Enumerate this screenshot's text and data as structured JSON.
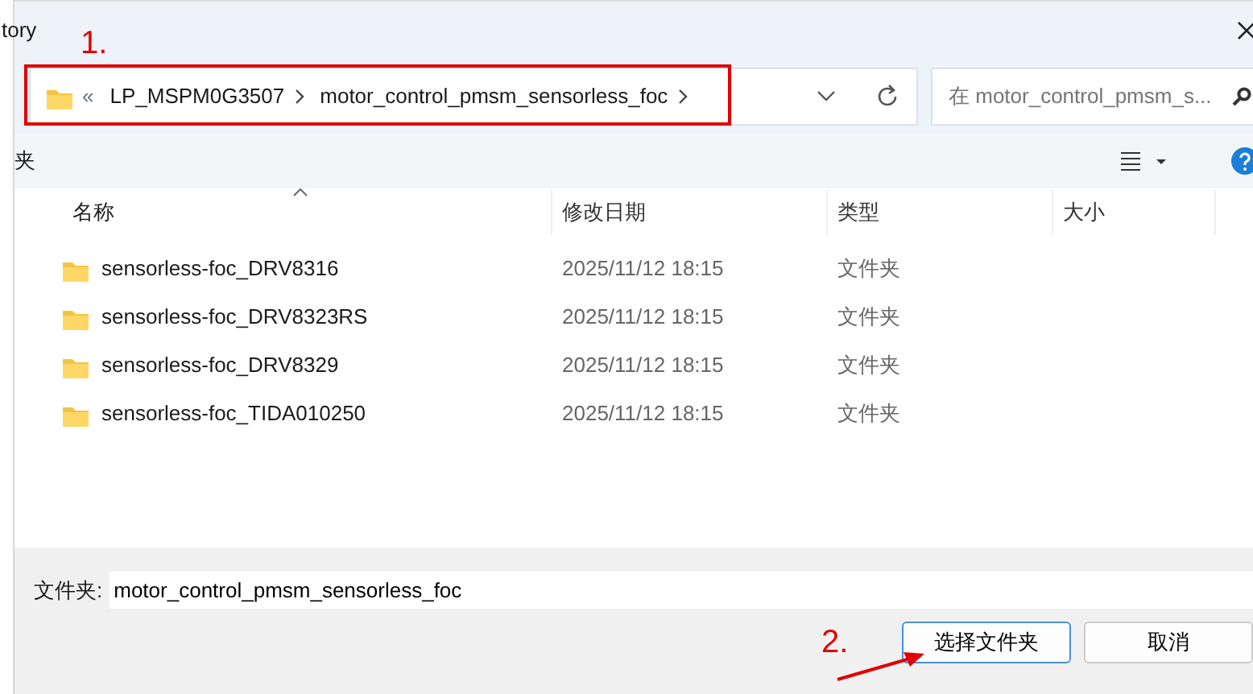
{
  "window": {
    "title": "tory"
  },
  "address_bar": {
    "overflow": "«",
    "segments": [
      "LP_MSPM0G3507",
      "motor_control_pmsm_sensorless_foc"
    ]
  },
  "search": {
    "placeholder": "在 motor_control_pmsm_s..."
  },
  "toolbar": {
    "label": "夹"
  },
  "table": {
    "columns": [
      {
        "label": "名称",
        "sorted": true
      },
      {
        "label": "修改日期",
        "sorted": false
      },
      {
        "label": "类型",
        "sorted": false
      },
      {
        "label": "大小",
        "sorted": false
      }
    ],
    "rows": [
      {
        "name": "sensorless-foc_DRV8316",
        "modified": "2025/11/12 18:15",
        "type": "文件夹"
      },
      {
        "name": "sensorless-foc_DRV8323RS",
        "modified": "2025/11/12 18:15",
        "type": "文件夹"
      },
      {
        "name": "sensorless-foc_DRV8329",
        "modified": "2025/11/12 18:15",
        "type": "文件夹"
      },
      {
        "name": "sensorless-foc_TIDA010250",
        "modified": "2025/11/12 18:15",
        "type": "文件夹"
      }
    ]
  },
  "folder_field": {
    "label": "文件夹:",
    "value": "motor_control_pmsm_sensorless_foc"
  },
  "buttons": [
    {
      "label": "选择文件夹",
      "kind": "primary"
    },
    {
      "label": "取消",
      "kind": "secondary"
    }
  ],
  "annotations": [
    {
      "label": "1.",
      "kind": "highlight"
    },
    {
      "label": "2.",
      "kind": "arrow"
    }
  ]
}
